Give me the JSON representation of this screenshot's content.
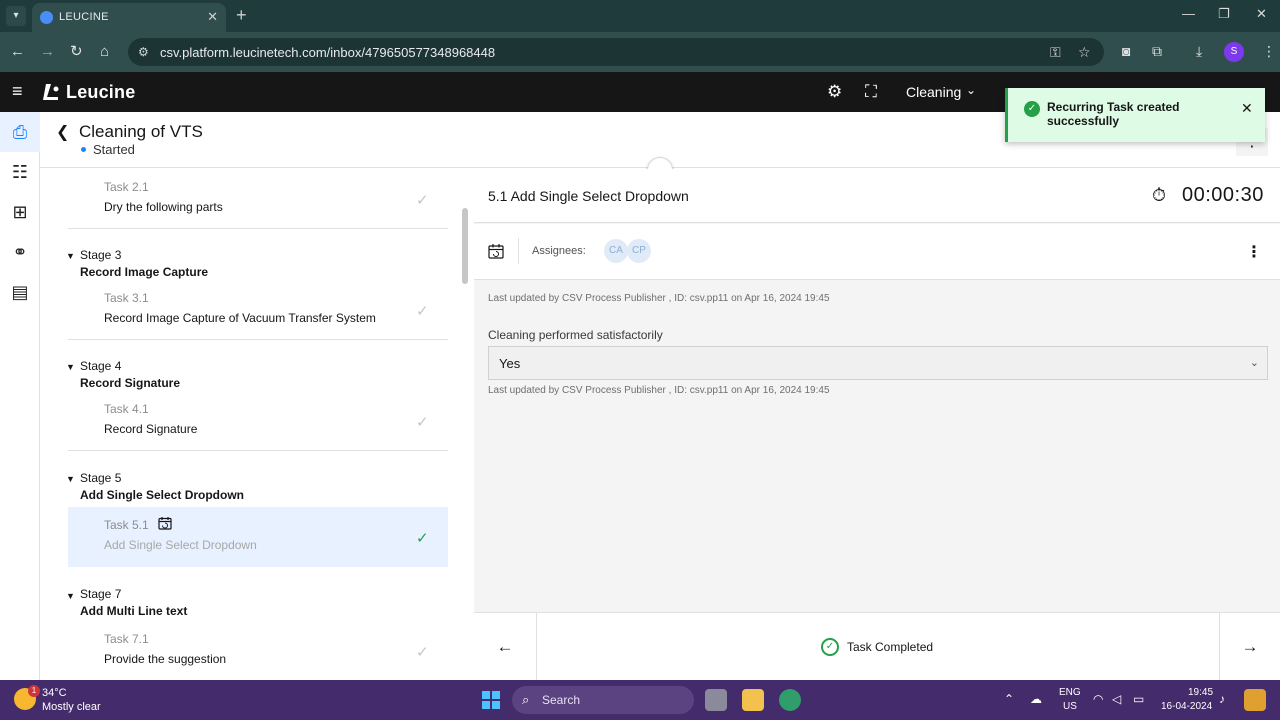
{
  "browser": {
    "tab_title": "LEUCINE",
    "url": "csv.platform.leucinetech.com/inbox/479650577348968448",
    "profile_initial": "S",
    "new_tab": "+",
    "tab_close": "✕",
    "win_minimize": "—",
    "win_restore": "❐",
    "win_close": "✕",
    "icons": [
      "back-icon",
      "forward-icon",
      "reload-icon",
      "home-icon",
      "site-info-icon",
      "password-key-icon",
      "bookmark-star-icon",
      "camera-icon",
      "extensions-icon",
      "download-icon",
      "menu-icon"
    ]
  },
  "app": {
    "logo": "Leucine",
    "facility": "Cleaning"
  },
  "job": {
    "title": "Cleaning of VTS",
    "status": "Started",
    "more": "⋮"
  },
  "stages": [
    {
      "tasks": [
        {
          "number": "Task 2.1",
          "name": "Dry the following parts",
          "completed": true,
          "active": false
        }
      ]
    },
    {
      "label": "Stage 3",
      "name": "Record Image Capture",
      "tasks": [
        {
          "number": "Task 3.1",
          "name": "Record Image Capture of Vacuum Transfer System",
          "completed": true,
          "active": false
        }
      ]
    },
    {
      "label": "Stage 4",
      "name": "Record Signature",
      "tasks": [
        {
          "number": "Task 4.1",
          "name": "Record Signature",
          "completed": true,
          "active": false
        }
      ]
    },
    {
      "label": "Stage 5",
      "name": "Add Single Select Dropdown",
      "tasks": [
        {
          "number": "Task 5.1",
          "name": "Add Single Select Dropdown",
          "completed": true,
          "active": true,
          "recurring": true
        }
      ]
    },
    {
      "label": "Stage 7",
      "name": "Add Multi Line text",
      "tasks": [
        {
          "number": "Task 7.1",
          "name": "Provide the suggestion",
          "completed": true,
          "active": false
        }
      ]
    }
  ],
  "task_panel": {
    "title": "5.1 Add Single Select Dropdown",
    "timer": "00:00:30",
    "assignees_label": "Assignees:",
    "assignees": [
      "CA",
      "CP"
    ],
    "meta": "Last updated by CSV Process Publisher , ID: csv.pp11 on Apr 16, 2024 19:45",
    "parameter": {
      "label": "Cleaning performed satisfactorily",
      "value": "Yes",
      "meta": "Last updated by CSV Process Publisher , ID: csv.pp11 on Apr 16, 2024 19:45"
    },
    "footer_status": "Task Completed"
  },
  "toast": {
    "message": "Recurring Task created successfully"
  },
  "taskbar": {
    "weather_badge": "1",
    "temperature": "34°C",
    "weather": "Mostly clear",
    "search": "Search",
    "lang_1": "ENG",
    "lang_2": "US",
    "time": "19:45",
    "date": "16-04-2024"
  },
  "colors": {
    "brand_dark": "#161616",
    "accent": "#1d84ff",
    "success": "#24a148",
    "active_row": "#e7f1ff",
    "browser_chrome": "#304e4e",
    "taskbar": "#442b6b"
  }
}
